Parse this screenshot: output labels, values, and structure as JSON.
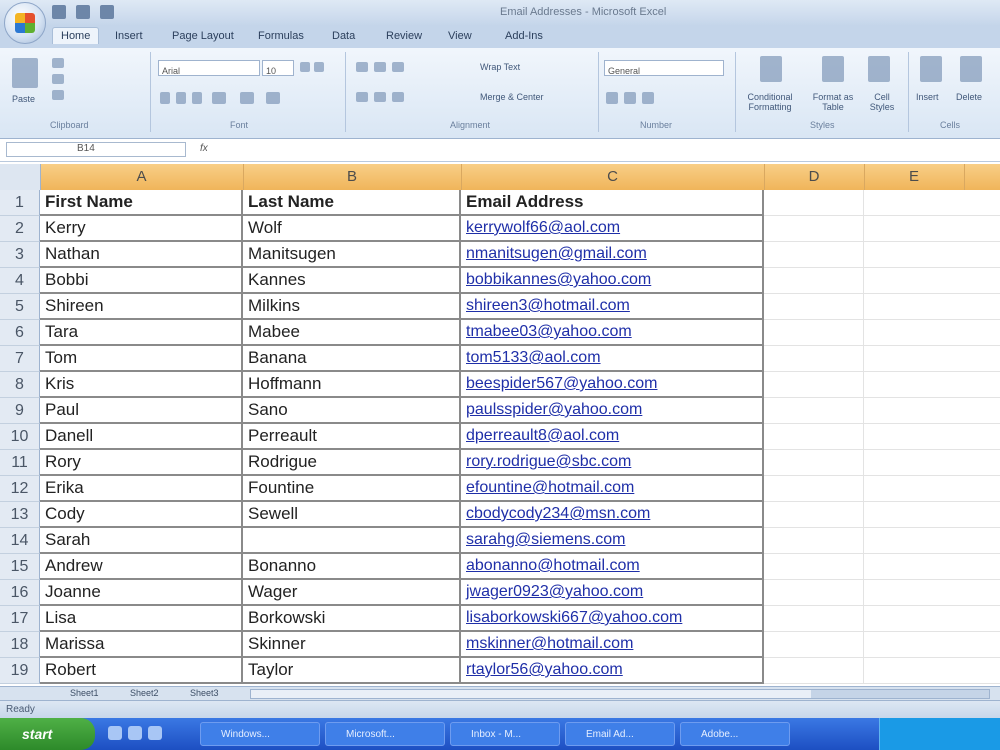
{
  "app": {
    "title": "Email Addresses - Microsoft Excel",
    "tabs": [
      "Home",
      "Insert",
      "Page Layout",
      "Formulas",
      "Data",
      "Review",
      "View",
      "Add-Ins"
    ]
  },
  "ribbon": {
    "groups": [
      "Clipboard",
      "Font",
      "Alignment",
      "Number",
      "Styles",
      "Cells"
    ],
    "font_name": "Arial",
    "font_size": "10",
    "number_format": "General",
    "paste_label": "Paste",
    "wrap_text": "Wrap Text",
    "merge_center": "Merge & Center",
    "conditional_formatting": "Conditional Formatting",
    "format_table": "Format as Table",
    "cell_styles": "Cell Styles",
    "insert": "Insert",
    "delete": "Delete"
  },
  "formula_bar": {
    "name_box": "B14",
    "fx": "fx",
    "content": ""
  },
  "columns": [
    "A",
    "B",
    "C",
    "D",
    "E"
  ],
  "rows": [
    {
      "n": "1",
      "a": "First Name",
      "b": "Last Name",
      "c": "Email Address",
      "hdr": true
    },
    {
      "n": "2",
      "a": "Kerry",
      "b": "Wolf",
      "c": "kerrywolf66@aol.com"
    },
    {
      "n": "3",
      "a": "Nathan",
      "b": "Manitsugen",
      "c": "nmanitsugen@gmail.com"
    },
    {
      "n": "4",
      "a": "Bobbi",
      "b": "Kannes",
      "c": "bobbikannes@yahoo.com"
    },
    {
      "n": "5",
      "a": "Shireen",
      "b": "Milkins",
      "c": "shireen3@hotmail.com"
    },
    {
      "n": "6",
      "a": "Tara",
      "b": "Mabee",
      "c": "tmabee03@yahoo.com"
    },
    {
      "n": "7",
      "a": "Tom",
      "b": "Banana",
      "c": "tom5133@aol.com"
    },
    {
      "n": "8",
      "a": "Kris",
      "b": "Hoffmann",
      "c": "beespider567@yahoo.com"
    },
    {
      "n": "9",
      "a": "Paul",
      "b": "Sano",
      "c": "paulsspider@yahoo.com"
    },
    {
      "n": "10",
      "a": "Danell",
      "b": "Perreault",
      "c": "dperreault8@aol.com"
    },
    {
      "n": "11",
      "a": "Rory",
      "b": "Rodrigue",
      "c": "rory.rodrigue@sbc.com"
    },
    {
      "n": "12",
      "a": "Erika",
      "b": "Fountine",
      "c": "efountine@hotmail.com"
    },
    {
      "n": "13",
      "a": "Cody",
      "b": "Sewell",
      "c": "cbodycody234@msn.com"
    },
    {
      "n": "14",
      "a": "Sarah",
      "b": "",
      "c": "sarahg@siemens.com"
    },
    {
      "n": "15",
      "a": "Andrew",
      "b": "Bonanno",
      "c": "abonanno@hotmail.com"
    },
    {
      "n": "16",
      "a": "Joanne",
      "b": "Wager",
      "c": "jwager0923@yahoo.com"
    },
    {
      "n": "17",
      "a": "Lisa",
      "b": "Borkowski",
      "c": "lisaborkowski667@yahoo.com"
    },
    {
      "n": "18",
      "a": "Marissa",
      "b": "Skinner",
      "c": "mskinner@hotmail.com"
    },
    {
      "n": "19",
      "a": "Robert",
      "b": "Taylor",
      "c": "rtaylor56@yahoo.com"
    }
  ],
  "sheets": [
    "Sheet1",
    "Sheet2",
    "Sheet3"
  ],
  "status": "Ready",
  "taskbar": {
    "start": "start",
    "tasks": [
      "Windows...",
      "Microsoft...",
      "Inbox - M...",
      "Email Ad...",
      "Adobe..."
    ]
  }
}
